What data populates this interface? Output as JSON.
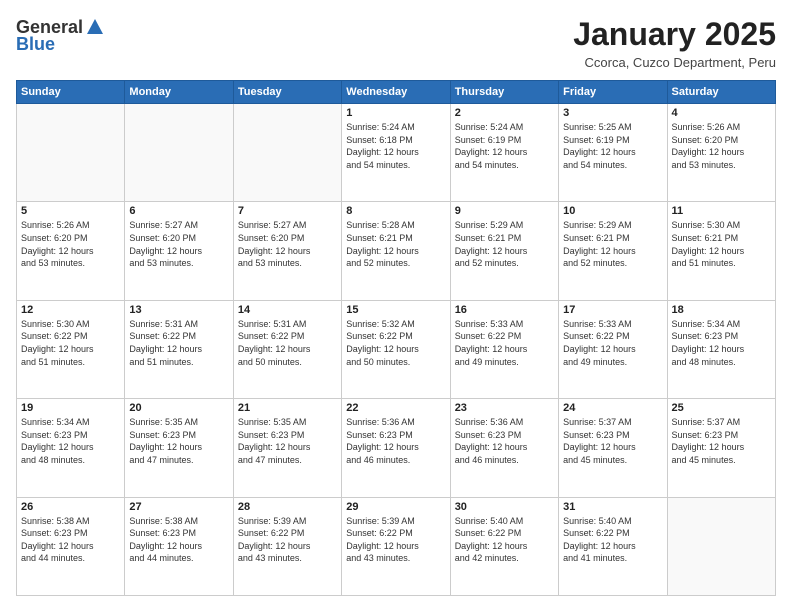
{
  "header": {
    "logo_general": "General",
    "logo_blue": "Blue",
    "month": "January 2025",
    "location": "Ccorca, Cuzco Department, Peru"
  },
  "days_of_week": [
    "Sunday",
    "Monday",
    "Tuesday",
    "Wednesday",
    "Thursday",
    "Friday",
    "Saturday"
  ],
  "weeks": [
    [
      {
        "day": "",
        "info": ""
      },
      {
        "day": "",
        "info": ""
      },
      {
        "day": "",
        "info": ""
      },
      {
        "day": "1",
        "info": "Sunrise: 5:24 AM\nSunset: 6:18 PM\nDaylight: 12 hours\nand 54 minutes."
      },
      {
        "day": "2",
        "info": "Sunrise: 5:24 AM\nSunset: 6:19 PM\nDaylight: 12 hours\nand 54 minutes."
      },
      {
        "day": "3",
        "info": "Sunrise: 5:25 AM\nSunset: 6:19 PM\nDaylight: 12 hours\nand 54 minutes."
      },
      {
        "day": "4",
        "info": "Sunrise: 5:26 AM\nSunset: 6:20 PM\nDaylight: 12 hours\nand 53 minutes."
      }
    ],
    [
      {
        "day": "5",
        "info": "Sunrise: 5:26 AM\nSunset: 6:20 PM\nDaylight: 12 hours\nand 53 minutes."
      },
      {
        "day": "6",
        "info": "Sunrise: 5:27 AM\nSunset: 6:20 PM\nDaylight: 12 hours\nand 53 minutes."
      },
      {
        "day": "7",
        "info": "Sunrise: 5:27 AM\nSunset: 6:20 PM\nDaylight: 12 hours\nand 53 minutes."
      },
      {
        "day": "8",
        "info": "Sunrise: 5:28 AM\nSunset: 6:21 PM\nDaylight: 12 hours\nand 52 minutes."
      },
      {
        "day": "9",
        "info": "Sunrise: 5:29 AM\nSunset: 6:21 PM\nDaylight: 12 hours\nand 52 minutes."
      },
      {
        "day": "10",
        "info": "Sunrise: 5:29 AM\nSunset: 6:21 PM\nDaylight: 12 hours\nand 52 minutes."
      },
      {
        "day": "11",
        "info": "Sunrise: 5:30 AM\nSunset: 6:21 PM\nDaylight: 12 hours\nand 51 minutes."
      }
    ],
    [
      {
        "day": "12",
        "info": "Sunrise: 5:30 AM\nSunset: 6:22 PM\nDaylight: 12 hours\nand 51 minutes."
      },
      {
        "day": "13",
        "info": "Sunrise: 5:31 AM\nSunset: 6:22 PM\nDaylight: 12 hours\nand 51 minutes."
      },
      {
        "day": "14",
        "info": "Sunrise: 5:31 AM\nSunset: 6:22 PM\nDaylight: 12 hours\nand 50 minutes."
      },
      {
        "day": "15",
        "info": "Sunrise: 5:32 AM\nSunset: 6:22 PM\nDaylight: 12 hours\nand 50 minutes."
      },
      {
        "day": "16",
        "info": "Sunrise: 5:33 AM\nSunset: 6:22 PM\nDaylight: 12 hours\nand 49 minutes."
      },
      {
        "day": "17",
        "info": "Sunrise: 5:33 AM\nSunset: 6:22 PM\nDaylight: 12 hours\nand 49 minutes."
      },
      {
        "day": "18",
        "info": "Sunrise: 5:34 AM\nSunset: 6:23 PM\nDaylight: 12 hours\nand 48 minutes."
      }
    ],
    [
      {
        "day": "19",
        "info": "Sunrise: 5:34 AM\nSunset: 6:23 PM\nDaylight: 12 hours\nand 48 minutes."
      },
      {
        "day": "20",
        "info": "Sunrise: 5:35 AM\nSunset: 6:23 PM\nDaylight: 12 hours\nand 47 minutes."
      },
      {
        "day": "21",
        "info": "Sunrise: 5:35 AM\nSunset: 6:23 PM\nDaylight: 12 hours\nand 47 minutes."
      },
      {
        "day": "22",
        "info": "Sunrise: 5:36 AM\nSunset: 6:23 PM\nDaylight: 12 hours\nand 46 minutes."
      },
      {
        "day": "23",
        "info": "Sunrise: 5:36 AM\nSunset: 6:23 PM\nDaylight: 12 hours\nand 46 minutes."
      },
      {
        "day": "24",
        "info": "Sunrise: 5:37 AM\nSunset: 6:23 PM\nDaylight: 12 hours\nand 45 minutes."
      },
      {
        "day": "25",
        "info": "Sunrise: 5:37 AM\nSunset: 6:23 PM\nDaylight: 12 hours\nand 45 minutes."
      }
    ],
    [
      {
        "day": "26",
        "info": "Sunrise: 5:38 AM\nSunset: 6:23 PM\nDaylight: 12 hours\nand 44 minutes."
      },
      {
        "day": "27",
        "info": "Sunrise: 5:38 AM\nSunset: 6:23 PM\nDaylight: 12 hours\nand 44 minutes."
      },
      {
        "day": "28",
        "info": "Sunrise: 5:39 AM\nSunset: 6:22 PM\nDaylight: 12 hours\nand 43 minutes."
      },
      {
        "day": "29",
        "info": "Sunrise: 5:39 AM\nSunset: 6:22 PM\nDaylight: 12 hours\nand 43 minutes."
      },
      {
        "day": "30",
        "info": "Sunrise: 5:40 AM\nSunset: 6:22 PM\nDaylight: 12 hours\nand 42 minutes."
      },
      {
        "day": "31",
        "info": "Sunrise: 5:40 AM\nSunset: 6:22 PM\nDaylight: 12 hours\nand 41 minutes."
      },
      {
        "day": "",
        "info": ""
      }
    ]
  ]
}
